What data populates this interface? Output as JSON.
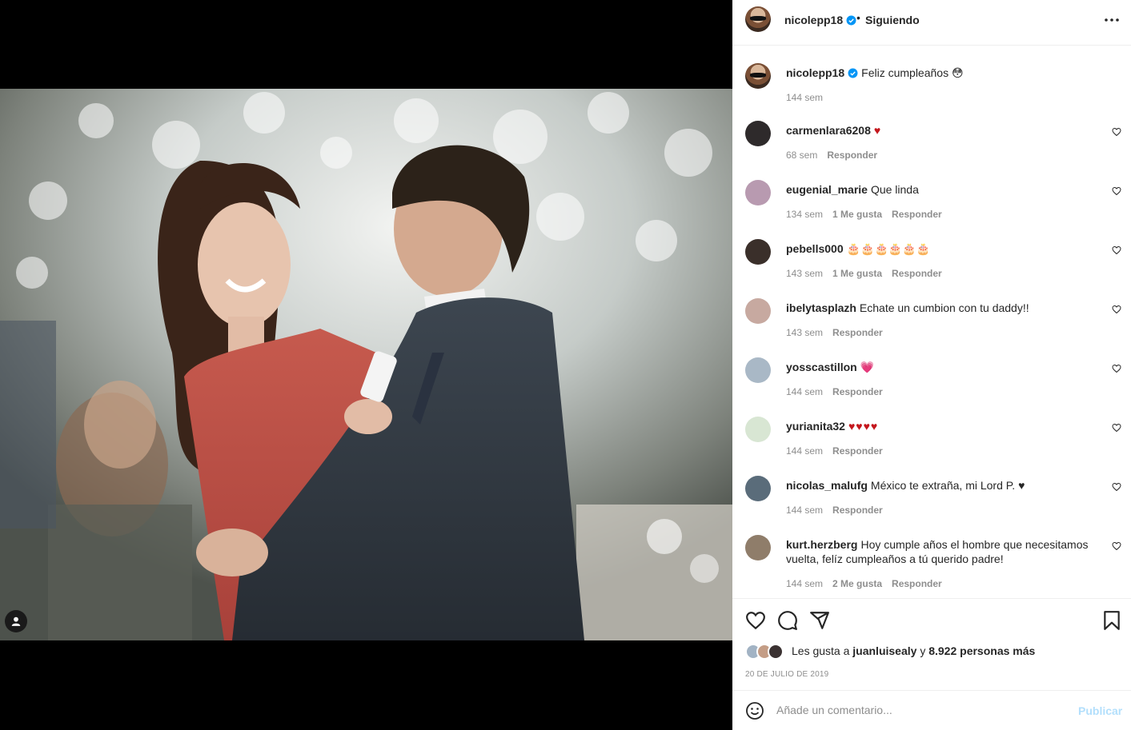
{
  "post": {
    "owner": "nicolepp18",
    "follow_status": "Siguiendo",
    "dot": "•",
    "caption_text": "Feliz cumpleaños 😳",
    "caption_time": "144 sem",
    "photo_alt": "Foto de la publicación"
  },
  "comments": [
    {
      "user": "carmenlara6208",
      "text": "♥",
      "time": "68 sem",
      "likes": "",
      "reply": "Responder",
      "avatar_color": "#2e2a2b"
    },
    {
      "user": "eugenial_marie",
      "text": "Que linda",
      "time": "134 sem",
      "likes": "1 Me gusta",
      "reply": "Responder",
      "avatar_color": "#b89ab0"
    },
    {
      "user": "pebells000",
      "text": "🎂🎂🎂🎂🎂🎂",
      "time": "143 sem",
      "likes": "1 Me gusta",
      "reply": "Responder",
      "avatar_color": "#3a2f2a"
    },
    {
      "user": "ibelytasplazh",
      "text": "Echate un cumbion con tu daddy!!",
      "time": "143 sem",
      "likes": "",
      "reply": "Responder",
      "avatar_color": "#c7a9a0"
    },
    {
      "user": "yosscastillon",
      "text": "💗",
      "time": "144 sem",
      "likes": "",
      "reply": "Responder",
      "avatar_color": "#a9b8c6"
    },
    {
      "user": "yurianita32",
      "text": "♥♥♥♥",
      "time": "144 sem",
      "likes": "",
      "reply": "Responder",
      "avatar_color": "#d8e6d3"
    },
    {
      "user": "nicolas_malufg",
      "text": "México te extraña, mi Lord P. ♥",
      "time": "144 sem",
      "likes": "",
      "reply": "Responder",
      "avatar_color": "#5a6c7a"
    },
    {
      "user": "kurt.herzberg",
      "text": "Hoy cumple años el hombre que necesitamos vuelta, felíz cumpleaños a tú querido padre!",
      "time": "144 sem",
      "likes": "2 Me gusta",
      "reply": "Responder",
      "avatar_color": "#8f7d6a"
    }
  ],
  "likes": {
    "prefix": "Les gusta a",
    "user": "juanluisealy",
    "joiner": "y",
    "others": "8.922 personas más"
  },
  "date": "20 DE JULIO DE 2019",
  "composer": {
    "placeholder": "Añade un comentario...",
    "publish": "Publicar"
  },
  "colors": {
    "verified": "#0095f6",
    "heart_red": "#c4161c",
    "publish_disabled": "#b2dffc"
  },
  "icons": [
    "more-options-icon",
    "verified-icon",
    "heart-icon",
    "comment-icon",
    "share-icon",
    "bookmark-icon",
    "emoji-icon",
    "user-tag-icon"
  ]
}
